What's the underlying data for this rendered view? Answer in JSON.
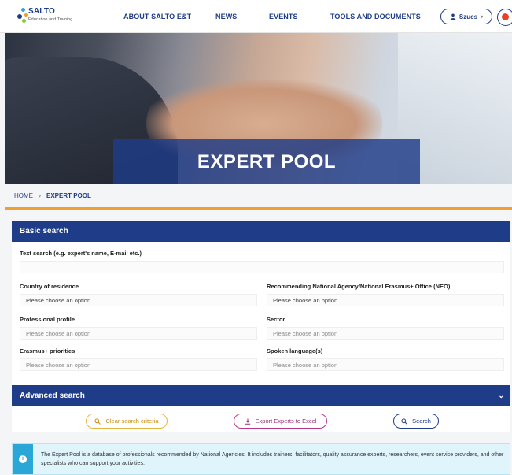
{
  "header": {
    "logo_text": "SALTO",
    "logo_sub": "Education and Training",
    "nav": [
      "ABOUT SALTO E&T",
      "NEWS",
      "EVENTS",
      "TOOLS AND DOCUMENTS"
    ],
    "user_label": "Szucs"
  },
  "hero": {
    "title": "EXPERT POOL"
  },
  "breadcrumb": {
    "home": "HOME",
    "current": "EXPERT POOL"
  },
  "basic_search": {
    "title": "Basic search",
    "text_search_label": "Text search (e.g. expert's name, E-mail etc.)",
    "text_search_value": "",
    "country_label": "Country of residence",
    "country_value": "Please choose an option",
    "agency_label": "Recommending National Agency/National Erasmus+ Office (NEO)",
    "agency_value": "Please choose an option",
    "profile_label": "Professional profile",
    "profile_value": "Please choose an option",
    "sector_label": "Sector",
    "sector_value": "Please choose an option",
    "priorities_label": "Erasmus+ priorities",
    "priorities_value": "Please choose an option",
    "language_label": "Spoken language(s)",
    "language_value": "Please choose an option"
  },
  "advanced_search": {
    "title": "Advanced search"
  },
  "actions": {
    "clear_label": "Clear search criteria",
    "export_label": "Export Experts to Excel",
    "search_label": "Search"
  },
  "info": {
    "text": "The Expert Pool is a database of professionals recommended by National Agencies. It includes trainers, facilitators, quality assurance experts, researchers, event service providers, and other specialists who can support your activities."
  },
  "colors": {
    "brand_blue": "#1f3c88",
    "accent_orange": "#f0a030",
    "clear_yellow": "#e6b540",
    "export_magenta": "#b5378c",
    "info_blue": "#2aa7d6"
  }
}
